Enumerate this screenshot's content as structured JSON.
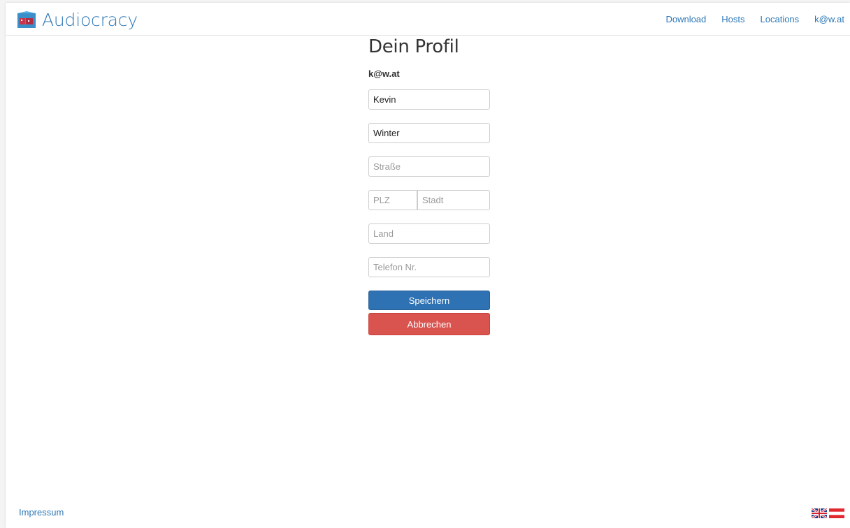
{
  "brand": {
    "name": "Audiocracy",
    "color": "#2f79b7"
  },
  "nav": {
    "items": [
      {
        "label": "Download"
      },
      {
        "label": "Hosts"
      },
      {
        "label": "Locations"
      },
      {
        "label": "k@w.at"
      }
    ]
  },
  "profile": {
    "title": "Dein Profil",
    "email": "k@w.at",
    "fields": {
      "first_name": {
        "value": "Kevin",
        "placeholder": ""
      },
      "last_name": {
        "value": "Winter",
        "placeholder": ""
      },
      "street": {
        "value": "",
        "placeholder": "Straße"
      },
      "zip": {
        "value": "",
        "placeholder": "PLZ"
      },
      "city": {
        "value": "",
        "placeholder": "Stadt"
      },
      "country": {
        "value": "",
        "placeholder": "Land"
      },
      "phone": {
        "value": "",
        "placeholder": "Telefon Nr."
      }
    },
    "save_label": "Speichern",
    "cancel_label": "Abbrechen",
    "colors": {
      "save": "#2f72b3",
      "cancel": "#d9534f"
    }
  },
  "footer": {
    "impressum_label": "Impressum",
    "flags": [
      "uk-flag-icon",
      "austria-flag-icon"
    ]
  }
}
